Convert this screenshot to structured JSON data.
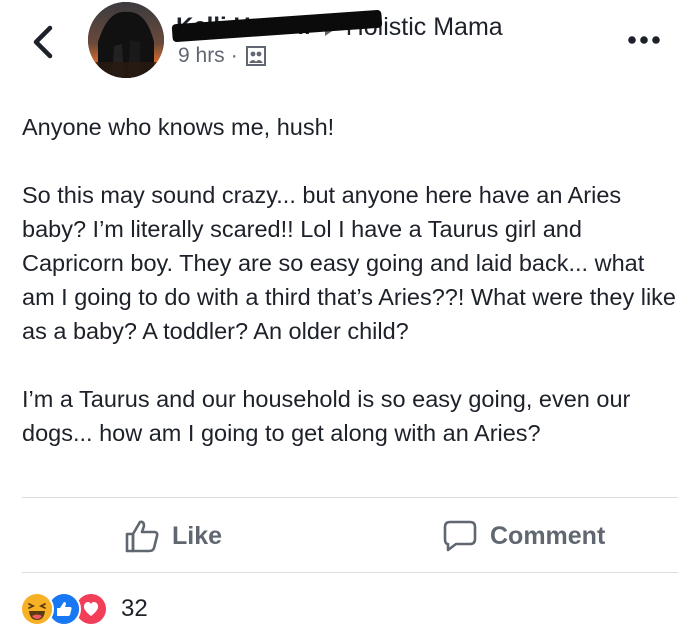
{
  "header": {
    "author_name": "Kelli Howell",
    "group_name": "Holistic Mama",
    "timestamp": "9 hrs",
    "separator": "·",
    "audience_icon": "group-members-icon",
    "back_icon": "chevron-left-icon",
    "more_icon": "more-options-icon"
  },
  "post": {
    "paragraphs": [
      "Anyone who knows me, hush!",
      "So this may sound crazy... but anyone here have an Aries baby? I’m literally scared!! Lol I have a Taurus girl and Capricorn boy. They are so easy going and laid back... what am I going to do with a third that’s Aries??! What were they like as a baby? A toddler? An older child?",
      "I’m a Taurus and our household is so easy going, even our dogs... how am I going to get along with an Aries?"
    ]
  },
  "actions": {
    "like_label": "Like",
    "comment_label": "Comment"
  },
  "reactions": {
    "icons": [
      "haha-icon",
      "like-icon",
      "love-icon"
    ],
    "count": "32"
  },
  "colors": {
    "text": "#1d2129",
    "secondary_text": "#606770",
    "like_blue": "#1877f2",
    "love_red": "#f33e58",
    "haha_yellow": "#f7b125",
    "divider": "#dadde1"
  }
}
